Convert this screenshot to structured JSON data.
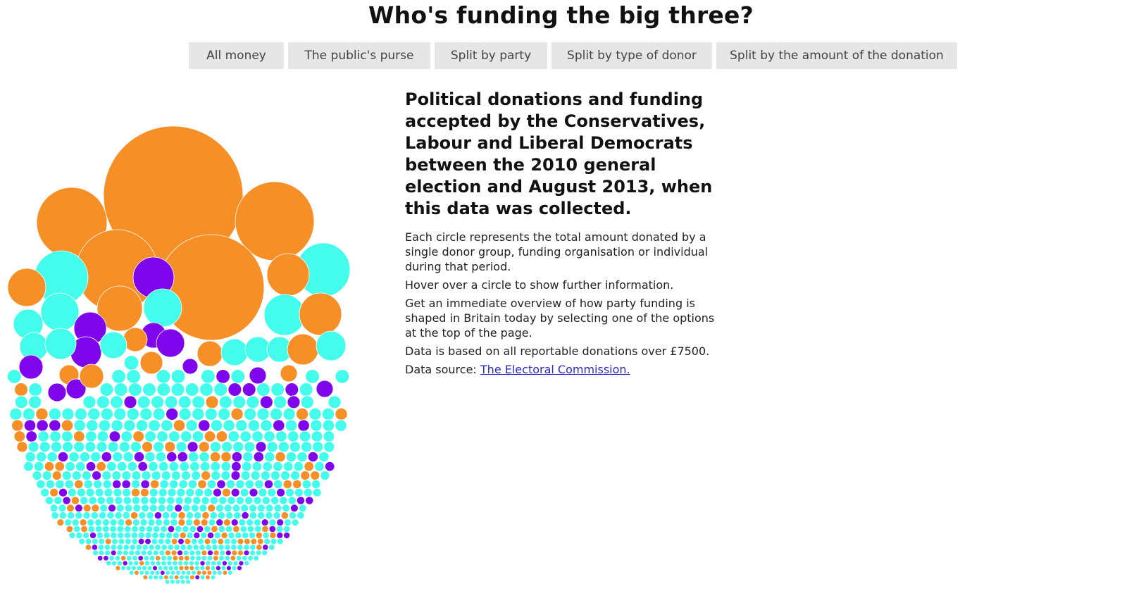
{
  "page": {
    "title": "Who's funding the big three?"
  },
  "nav": {
    "buttons": [
      {
        "label": "All money"
      },
      {
        "label": "The public's purse"
      },
      {
        "label": "Split by party"
      },
      {
        "label": "Split by type of donor"
      },
      {
        "label": "Split by the amount of the donation"
      }
    ]
  },
  "description": {
    "heading": "Political donations and funding accepted by the Conservatives, Labour and Liberal Democrats between the 2010 general election and August 2013, when this data was collected.",
    "paragraphs": [
      "Each circle represents the total amount donated by a single donor group, funding organisation or individual during that period.",
      "Hover over a circle to show further information.",
      "Get an immediate overview of how party funding is shaped in Britain today by selecting one of the options at the top of the page.",
      "Data is based on all reportable donations over £7500."
    ],
    "source_prefix": "Data source: ",
    "source_link": "The Electoral Commission."
  },
  "colors": {
    "orange": "#f78f27",
    "cyan": "#44fcec",
    "purple": "#7f06ec"
  }
}
